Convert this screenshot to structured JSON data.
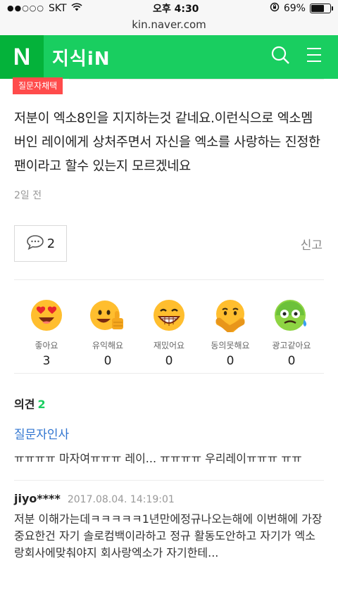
{
  "status": {
    "signal": "●●○○○",
    "carrier": "SKT",
    "time": "오후 4:30",
    "battery": "69%",
    "battery_level": 0.69
  },
  "url": "kin.naver.com",
  "header": {
    "logo": "N",
    "brand": "지식iN",
    "accent": "#19ce60",
    "logo_bg": "#04b23a"
  },
  "badge": "질문자채택",
  "question": "저분이 엑소8인을 지지하는것 같네요.이런식으로 엑소멤버인 레이에게 상처주면서 자신을 엑소를 사랑하는 진정한 팬이라고 할수 있는지 모르겠네요",
  "time_ago": "2일 전",
  "comment_count": "2",
  "report": "신고",
  "emotions": [
    {
      "icon": "heart-eyes-face-icon",
      "label": "좋아요",
      "count": "3"
    },
    {
      "icon": "thumbs-up-face-icon",
      "label": "유익해요",
      "count": "0"
    },
    {
      "icon": "grinning-face-icon",
      "label": "재밌어요",
      "count": "0"
    },
    {
      "icon": "crossed-arms-face-icon",
      "label": "동의못해요",
      "count": "0"
    },
    {
      "icon": "sick-face-icon",
      "label": "광고같아요",
      "count": "0"
    }
  ],
  "opinions": {
    "title": "의견",
    "count": "2",
    "first": {
      "author_label": "질문자인사",
      "text": "ㅠㅠㅠㅠ 마자여ㅠㅠㅠ 레이... ㅠㅠㅠㅠ 우리레이ㅠㅠㅠ ㅠㅠ"
    },
    "second": {
      "author": "jiyo****",
      "date": "2017.08.04. 14:19:01",
      "text": "저분 이해가는데ㅋㅋㅋㅋㅋ1년만에정규나오는해에 이번해에 가장중요한건 자기 솔로컴백이라하고 정규 활동도안하고 자기가 엑소랑회사에맞춰야지 회사랑엑소가 자기한테..."
    }
  }
}
